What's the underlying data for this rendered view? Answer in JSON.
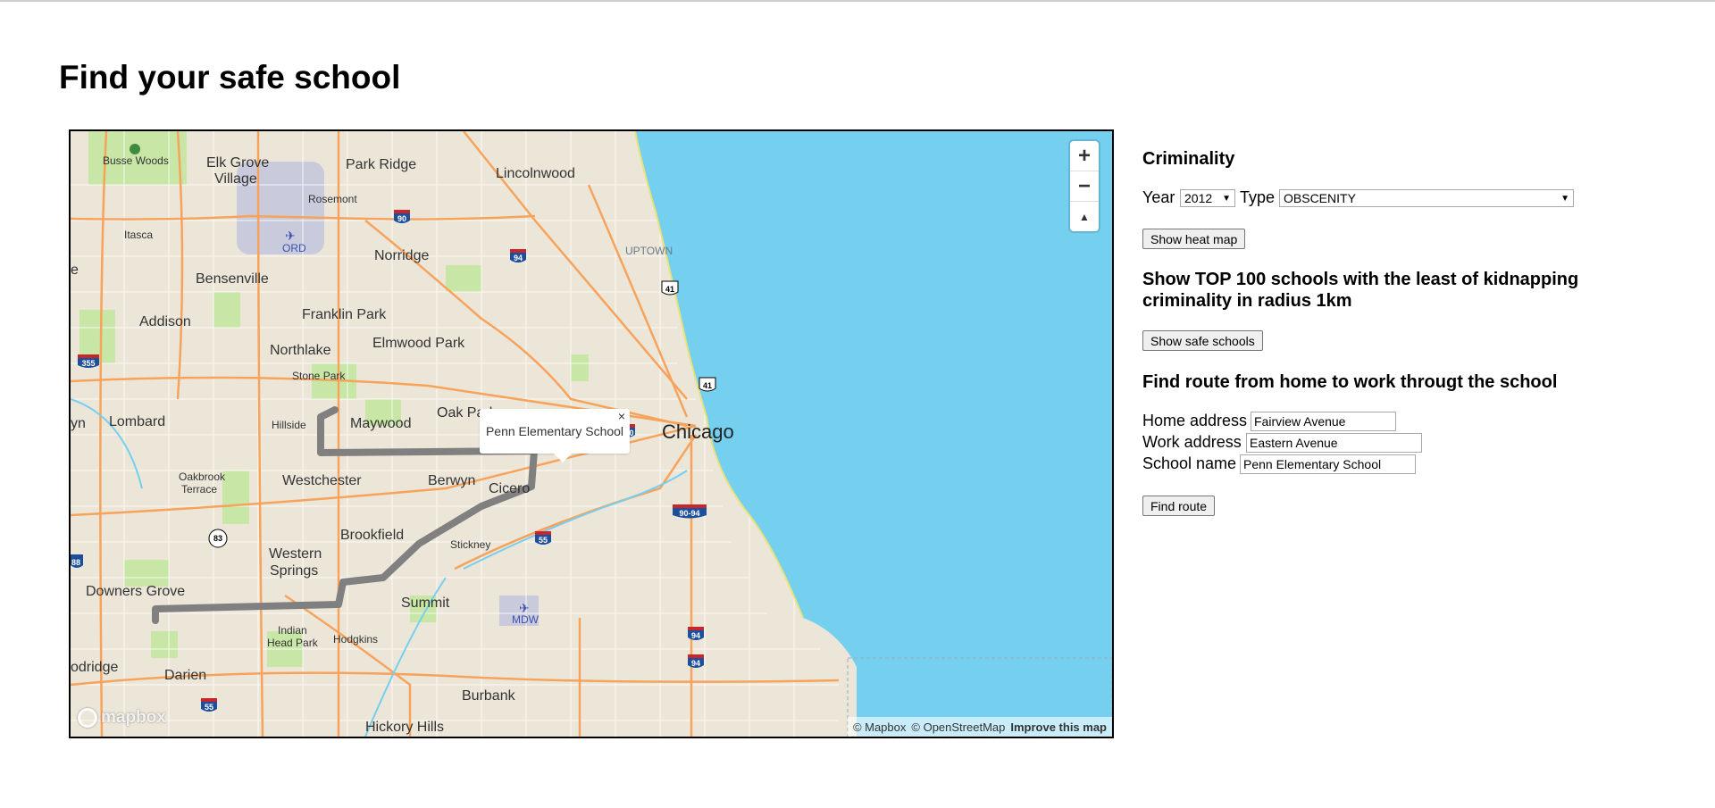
{
  "page": {
    "title": "Find your safe school"
  },
  "map": {
    "popup_text": "Penn Elementary School",
    "popup_close": "×",
    "controls": {
      "zoom_in": "+",
      "zoom_out": "−",
      "compass": "▲"
    },
    "logo_text": "mapbox",
    "attribution": {
      "mapbox": "© Mapbox",
      "osm": "© OpenStreetMap",
      "improve": "Improve this map"
    },
    "labels": {
      "busse_woods": "Busse Woods",
      "elk_grove": "Elk Grove",
      "village": "Village",
      "park_ridge": "Park Ridge",
      "lincolnwood": "Lincolnwood",
      "rosemont": "Rosemont",
      "itasca": "Itasca",
      "ord": "ORD",
      "norridge": "Norridge",
      "uptown": "UPTOWN",
      "bensenville": "Bensenville",
      "addison": "Addison",
      "franklin_park": "Franklin Park",
      "northlake": "Northlake",
      "elmwood_park": "Elmwood Park",
      "stone_park": "Stone Park",
      "lombard": "Lombard",
      "hillside": "Hillside",
      "maywood": "Maywood",
      "oak_park": "Oak Park",
      "chicago": "Chicago",
      "oakbrook": "Oakbrook",
      "terrace": "Terrace",
      "westchester": "Westchester",
      "berwyn": "Berwyn",
      "cicero": "Cicero",
      "brookfield": "Brookfield",
      "stickney": "Stickney",
      "western": "Western",
      "springs": "Springs",
      "downers_grove": "Downers Grove",
      "summit": "Summit",
      "mdw": "MDW",
      "indian": "Indian",
      "head_park": "Head Park",
      "hodgkins": "Hodgkins",
      "darien": "Darien",
      "burbank": "Burbank",
      "hickory_hills": "Hickory Hills",
      "odridge": "odridge",
      "yn": "yn",
      "e": "e"
    },
    "shields": {
      "i90": "90",
      "i94a": "94",
      "us41a": "41",
      "us41b": "41",
      "i355": "355",
      "i290": "290",
      "il83": "83",
      "i88": "88",
      "i55a": "55",
      "i9094": "90-94",
      "i94b": "94",
      "i94c": "94",
      "i55b": "55"
    }
  },
  "criminality": {
    "heading": "Criminality",
    "year_label": "Year",
    "year_value": "2012",
    "type_label": "Type",
    "type_value": "OBSCENITY",
    "heat_button": "Show heat map"
  },
  "top_schools": {
    "heading_line1": "Show TOP 100 schools with the least of kidnapping",
    "heading_line2": "criminality in radius 1km",
    "button": "Show safe schools"
  },
  "route": {
    "heading": "Find route from home to work througt the school",
    "home_label": "Home address",
    "home_value": "Fairview Avenue",
    "work_label": "Work address",
    "work_value": "Eastern Avenue",
    "school_label": "School name",
    "school_value": "Penn Elementary School",
    "button": "Find route"
  },
  "colors": {
    "water": "#75cfef",
    "land": "#ece6d9",
    "park": "#c8e6a5",
    "highway": "#f7a35c",
    "interstate": "#1c4f9c",
    "route": "#808080",
    "airport": "#c9cbdc"
  }
}
